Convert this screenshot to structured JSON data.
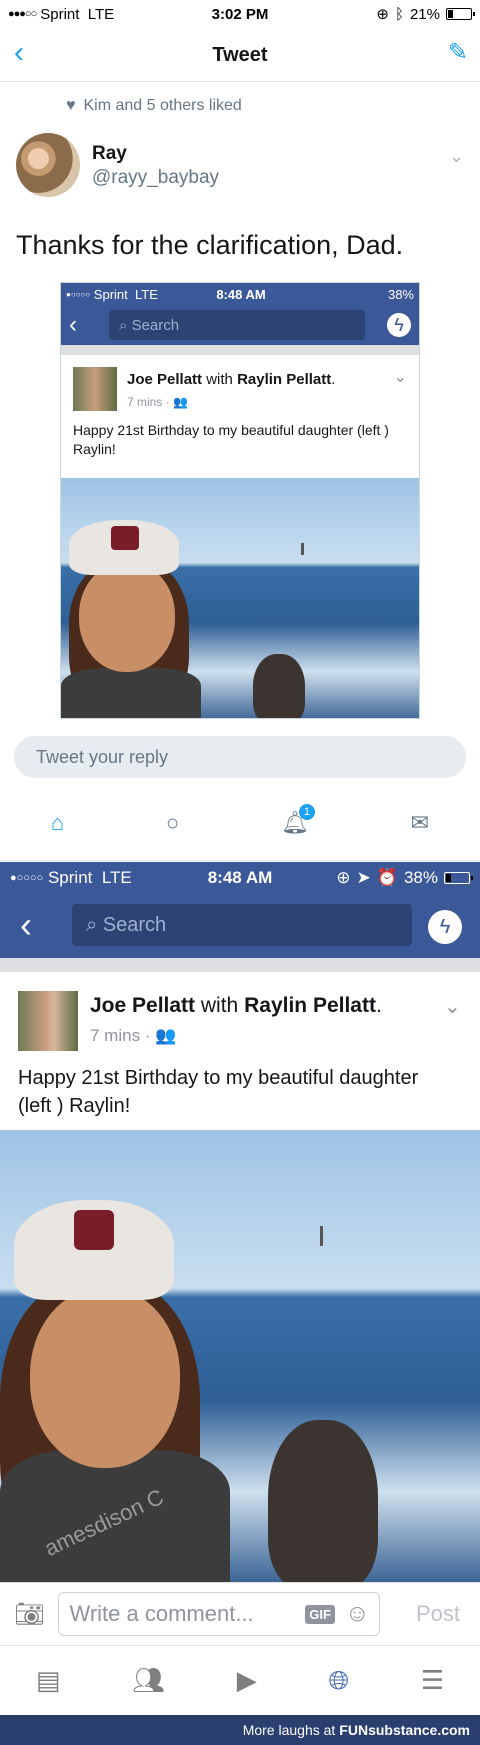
{
  "status_bar": {
    "carrier": "Sprint",
    "network": "LTE",
    "time": "3:02 PM",
    "battery": "21%"
  },
  "header": {
    "title": "Tweet"
  },
  "tweet": {
    "liked_text": "Kim and 5 others liked",
    "author_name": "Ray",
    "author_handle": "@rayy_baybay",
    "text": "Thanks for the clarification, Dad."
  },
  "embedded_fb": {
    "status": {
      "carrier": "Sprint",
      "network": "LTE",
      "time": "8:48 AM",
      "battery": "38%"
    },
    "search_placeholder": "Search",
    "post_author": "Joe Pellatt",
    "with_text": "with",
    "tagged": "Raylin Pellatt",
    "period": ".",
    "time": "7 mins",
    "text": "Happy 21st Birthday to my beautiful daughter (left ) Raylin!"
  },
  "reply": {
    "placeholder": "Tweet your reply"
  },
  "tabbar": {
    "notifications_badge": "1"
  },
  "fb": {
    "status": {
      "carrier": "Sprint",
      "network": "LTE",
      "time": "8:48 AM",
      "battery": "38%"
    },
    "search_placeholder": "Search",
    "post_author": "Joe Pellatt",
    "with_text": "with",
    "tagged": "Raylin Pellatt",
    "period": ".",
    "time": "7 mins",
    "text_line1": "Happy 21st Birthday to my beautiful daughter",
    "text_line2": "(left ) Raylin!",
    "shirt_text": "amesdison C",
    "comment_placeholder": "Write a comment...",
    "gif_label": "GIF",
    "post_button": "Post"
  },
  "footer": {
    "text": "More laughs at",
    "brand": "FUNsubstance.com"
  },
  "colors": {
    "twitter_blue": "#1da1f2",
    "facebook_blue": "#3b5998"
  }
}
